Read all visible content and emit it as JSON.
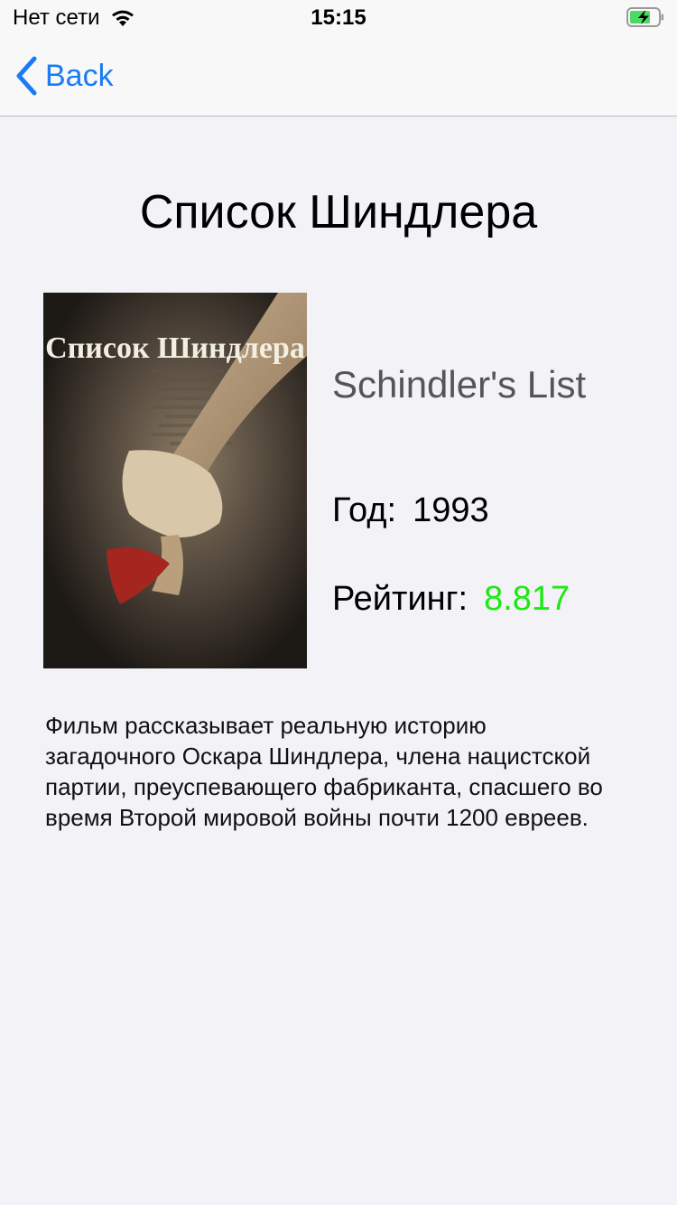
{
  "status_bar": {
    "carrier": "Нет сети",
    "time": "15:15"
  },
  "nav": {
    "back_label": "Back"
  },
  "movie": {
    "title": "Список Шиндлера",
    "original_title": "Schindler's List",
    "poster_title": "Список Шиндлера",
    "year_label": "Год:",
    "year": "1993",
    "rating_label": "Рейтинг:",
    "rating": "8.817",
    "description": "Фильм рассказывает реальную историю загадочного Оскара Шиндлера, члена нацистской партии, преуспевающего фабриканта, спасшего во время Второй мировой войны почти 1200 евреев."
  },
  "colors": {
    "accent": "#1a7cf5",
    "rating": "#1bea0f",
    "background": "#f2f2f7",
    "battery": "#4cd964"
  }
}
